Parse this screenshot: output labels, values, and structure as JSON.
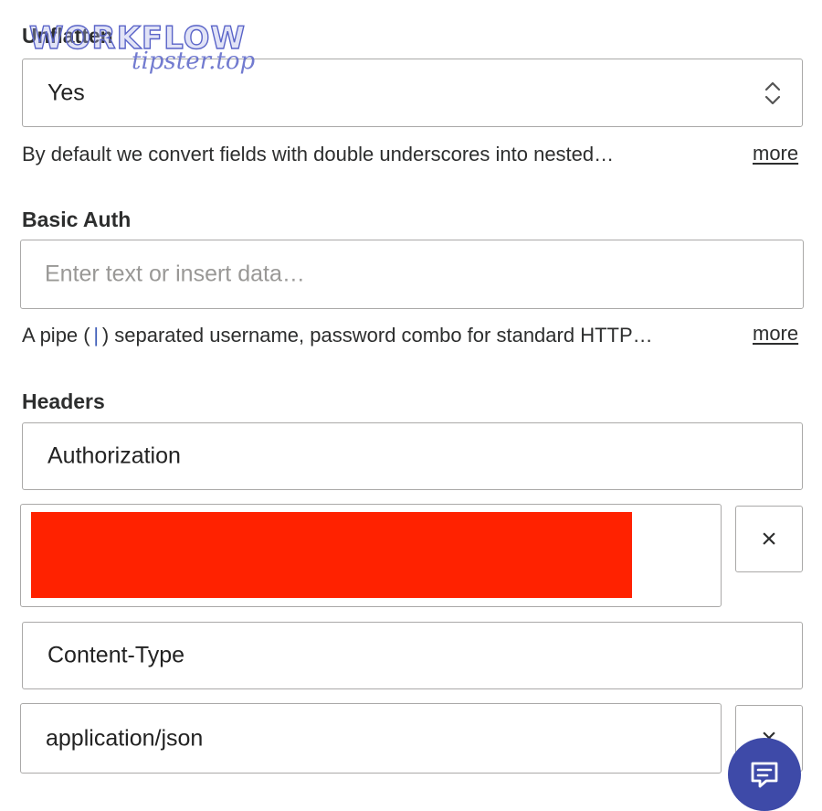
{
  "unflatten": {
    "label": "Unflatten",
    "value": "Yes",
    "help": "By default we convert fields with double underscores into nested…",
    "more": "more"
  },
  "basic_auth": {
    "label": "Basic Auth",
    "placeholder": "Enter text or insert data…",
    "help_before": "A pipe (",
    "help_pipe": "|",
    "help_after": ") separated username, password combo for standard HTTP…",
    "more": "more"
  },
  "headers": {
    "label": "Headers",
    "pairs": [
      {
        "key": "Authorization",
        "value": ""
      },
      {
        "key": "Content-Type",
        "value": "application/json"
      }
    ],
    "remove_glyph": "×"
  },
  "watermark": {
    "title": "WORKFLOW",
    "subtitle": "tipster.top"
  },
  "colors": {
    "redaction": "#ff2200",
    "chat_button": "#3e4aa8",
    "pipe_accent": "#3f5db8"
  },
  "icons": {
    "select_toggle": "chevron-up-down-icon",
    "remove": "close-icon",
    "chat": "chat-icon"
  }
}
